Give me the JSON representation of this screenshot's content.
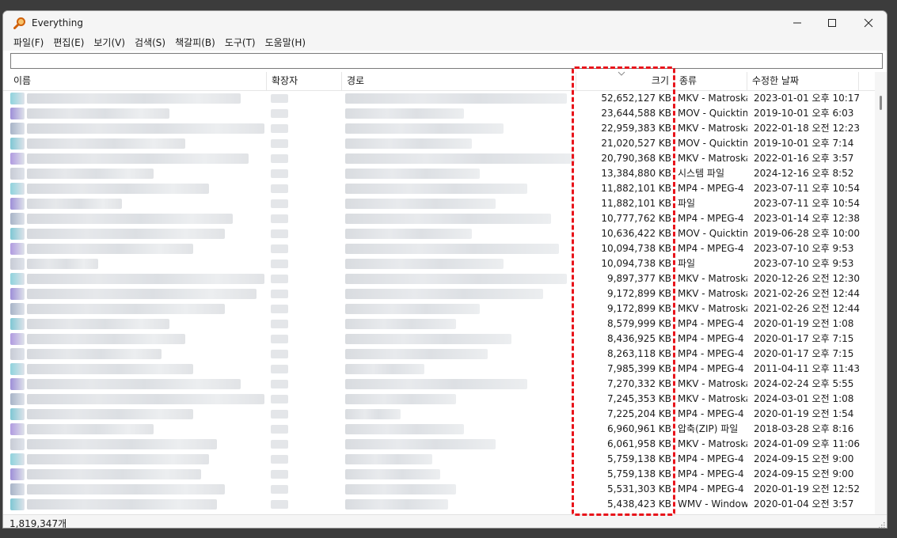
{
  "window": {
    "title": "Everything",
    "icon": "magnifier-icon",
    "accent_color": "#e07a10"
  },
  "menu": [
    "파일(F)",
    "편집(E)",
    "보기(V)",
    "검색(S)",
    "책갈피(B)",
    "도구(T)",
    "도움말(H)"
  ],
  "search": {
    "value": "",
    "placeholder": ""
  },
  "columns": {
    "name": "이름",
    "ext": "확장자",
    "path": "경로",
    "size": "크기",
    "type": "종류",
    "modified": "수정한 날짜"
  },
  "sort": {
    "column": "size",
    "direction": "descending"
  },
  "rows": [
    {
      "size": "52,652,127 KB",
      "type": "MKV - Matroska",
      "date": "2023-01-01 오후 10:17"
    },
    {
      "size": "23,644,588 KB",
      "type": "MOV - Quicktime",
      "date": "2019-10-01 오후 6:03"
    },
    {
      "size": "22,959,383 KB",
      "type": "MKV - Matroska",
      "date": "2022-01-18 오전 12:23"
    },
    {
      "size": "21,020,527 KB",
      "type": "MOV - Quicktime",
      "date": "2019-10-01 오후 7:14"
    },
    {
      "size": "20,790,368 KB",
      "type": "MKV - Matroska",
      "date": "2022-01-16 오후 3:57"
    },
    {
      "size": "13,384,880 KB",
      "type": "시스템 파일",
      "date": "2024-12-16 오후 8:52"
    },
    {
      "size": "11,882,101 KB",
      "type": "MP4 - MPEG-4",
      "date": "2023-07-11 오후 10:54"
    },
    {
      "size": "11,882,101 KB",
      "type": "파일",
      "date": "2023-07-11 오후 10:54"
    },
    {
      "size": "10,777,762 KB",
      "type": "MP4 - MPEG-4",
      "date": "2023-01-14 오후 12:38"
    },
    {
      "size": "10,636,422 KB",
      "type": "MOV - Quicktime",
      "date": "2019-06-28 오후 10:00"
    },
    {
      "size": "10,094,738 KB",
      "type": "MP4 - MPEG-4",
      "date": "2023-07-10 오후 9:53"
    },
    {
      "size": "10,094,738 KB",
      "type": "파일",
      "date": "2023-07-10 오후 9:53"
    },
    {
      "size": "9,897,377 KB",
      "type": "MKV - Matroska",
      "date": "2020-12-26 오전 12:30"
    },
    {
      "size": "9,172,899 KB",
      "type": "MKV - Matroska",
      "date": "2021-02-26 오전 12:44"
    },
    {
      "size": "9,172,899 KB",
      "type": "MKV - Matroska",
      "date": "2021-02-26 오전 12:44"
    },
    {
      "size": "8,579,999 KB",
      "type": "MP4 - MPEG-4",
      "date": "2020-01-19 오전 1:08"
    },
    {
      "size": "8,436,925 KB",
      "type": "MP4 - MPEG-4",
      "date": "2020-01-17 오후 7:15"
    },
    {
      "size": "8,263,118 KB",
      "type": "MP4 - MPEG-4",
      "date": "2020-01-17 오후 7:15"
    },
    {
      "size": "7,985,399 KB",
      "type": "MP4 - MPEG-4",
      "date": "2011-04-11 오후 11:43"
    },
    {
      "size": "7,270,332 KB",
      "type": "MKV - Matroska",
      "date": "2024-02-24 오후 5:55"
    },
    {
      "size": "7,245,353 KB",
      "type": "MKV - Matroska",
      "date": "2024-03-01 오전 1:08"
    },
    {
      "size": "7,225,204 KB",
      "type": "MP4 - MPEG-4",
      "date": "2020-01-19 오전 1:54"
    },
    {
      "size": "6,960,961 KB",
      "type": "압축(ZIP) 파일",
      "date": "2018-03-28 오후 8:16"
    },
    {
      "size": "6,061,958 KB",
      "type": "MKV - Matroska",
      "date": "2024-01-09 오후 11:06"
    },
    {
      "size": "5,759,138 KB",
      "type": "MP4 - MPEG-4",
      "date": "2024-09-15 오전 9:00"
    },
    {
      "size": "5,759,138 KB",
      "type": "MP4 - MPEG-4",
      "date": "2024-09-15 오전 9:00"
    },
    {
      "size": "5,531,303 KB",
      "type": "MP4 - MPEG-4",
      "date": "2020-01-19 오전 12:52"
    },
    {
      "size": "5,438,423 KB",
      "type": "WMV - Windows Media",
      "date": "2020-01-04 오전 3:57"
    }
  ],
  "status": {
    "count": "1,819,347개"
  },
  "annotation": {
    "color": "#e8141b",
    "style": "dashed",
    "target": "size-column"
  }
}
